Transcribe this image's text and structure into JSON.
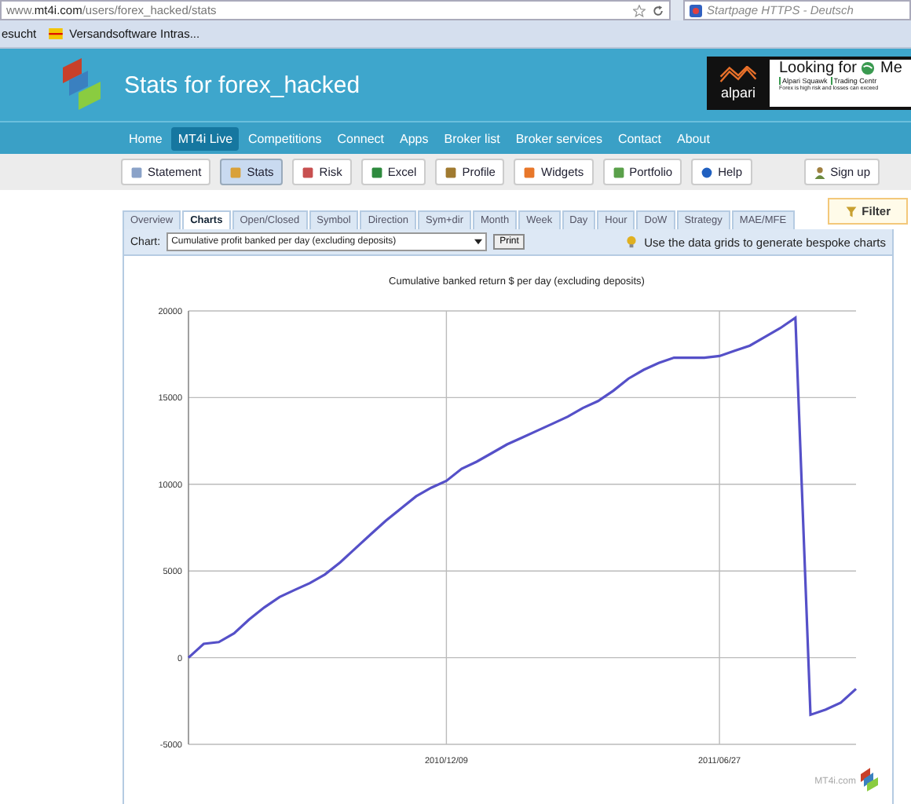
{
  "browser": {
    "url": "www.**mt4i.com**/users/forex_hacked/stats",
    "search": "Startpage HTTPS - Deutsch",
    "bookmarks": [
      "esucht",
      "Versandsoftware Intras..."
    ]
  },
  "header": {
    "title": "Stats for forex_hacked",
    "ad": {
      "brand": "alpari",
      "headline": "Looking for",
      "headline_cut": "Me",
      "links": [
        "Alpari Squawk",
        "Trading Centr"
      ],
      "disclaimer": "Forex is high risk and losses can exceed"
    }
  },
  "nav": [
    {
      "label": "Home",
      "selected": false
    },
    {
      "label": "MT4i Live",
      "selected": true
    },
    {
      "label": "Competitions",
      "selected": false
    },
    {
      "label": "Connect",
      "selected": false
    },
    {
      "label": "Apps",
      "selected": false
    },
    {
      "label": "Broker list",
      "selected": false
    },
    {
      "label": "Broker services",
      "selected": false
    },
    {
      "label": "Contact",
      "selected": false
    },
    {
      "label": "About",
      "selected": false
    }
  ],
  "toolbar": [
    {
      "label": "Statement",
      "selected": false
    },
    {
      "label": "Stats",
      "selected": true
    },
    {
      "label": "Risk",
      "selected": false
    },
    {
      "label": "Excel",
      "selected": false
    },
    {
      "label": "Profile",
      "selected": false
    },
    {
      "label": "Widgets",
      "selected": false
    },
    {
      "label": "Portfolio",
      "selected": false
    },
    {
      "label": "Help",
      "selected": false
    }
  ],
  "signup": "Sign up",
  "filter": "Filter",
  "tabs": [
    {
      "label": "Overview",
      "selected": false
    },
    {
      "label": "Charts",
      "selected": true
    },
    {
      "label": "Open/Closed",
      "selected": false
    },
    {
      "label": "Symbol",
      "selected": false
    },
    {
      "label": "Direction",
      "selected": false
    },
    {
      "label": "Sym+dir",
      "selected": false
    },
    {
      "label": "Month",
      "selected": false
    },
    {
      "label": "Week",
      "selected": false
    },
    {
      "label": "Day",
      "selected": false
    },
    {
      "label": "Hour",
      "selected": false
    },
    {
      "label": "DoW",
      "selected": false
    },
    {
      "label": "Strategy",
      "selected": false
    },
    {
      "label": "MAE/MFE",
      "selected": false
    }
  ],
  "chart_bar": {
    "label": "Chart:",
    "select_value": "Cumulative profit banked per day (excluding deposits)",
    "print": "Print",
    "hint": "Use the data grids to generate bespoke charts"
  },
  "chart_data": {
    "type": "line",
    "title": "Cumulative banked return $ per day (excluding deposits)",
    "categories": [
      null,
      null,
      null,
      null,
      null,
      null,
      null,
      null,
      null,
      null,
      null,
      null,
      null,
      null,
      null,
      null,
      null,
      "2010/12/09",
      null,
      null,
      null,
      null,
      null,
      null,
      null,
      null,
      null,
      null,
      null,
      null,
      null,
      null,
      null,
      null,
      null,
      "2011/06/27",
      null,
      null,
      null,
      null,
      null,
      null,
      null,
      null,
      null
    ],
    "series": [
      {
        "color": "#5550c8",
        "values": [
          0,
          800,
          900,
          1400,
          2200,
          2900,
          3500,
          3900,
          4300,
          4800,
          5500,
          6300,
          7100,
          7900,
          8600,
          9300,
          9800,
          10200,
          10900,
          11300,
          11800,
          12300,
          12700,
          13100,
          13500,
          13900,
          14400,
          14800,
          15400,
          16100,
          16600,
          17000,
          17300,
          17300,
          17300,
          17400,
          17700,
          18000,
          18500,
          19000,
          19600,
          -3300,
          -3000,
          -2600,
          -1800
        ]
      }
    ],
    "ylim": [
      -5000,
      20000
    ],
    "grid": true,
    "yticks": [
      -5000,
      0,
      5000,
      10000,
      15000,
      20000
    ]
  },
  "credit": "MT4i.com"
}
